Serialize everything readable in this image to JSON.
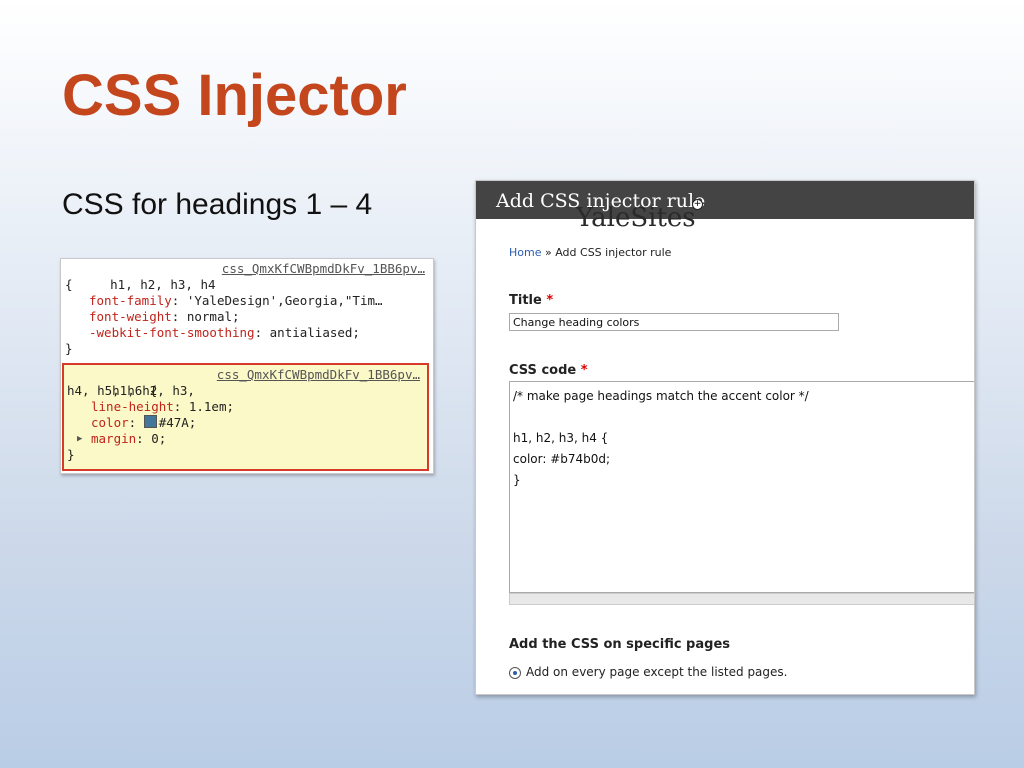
{
  "slide": {
    "title": "CSS Injector",
    "subtitle": "CSS for headings 1 – 4",
    "accent_color": "#c4461d"
  },
  "devtools": {
    "rule1": {
      "selector": "h1, h2, h3, h4",
      "source": "css_QmxKfCWBpmdDkFv_1BB6pv…",
      "open_brace": "{",
      "declarations": [
        {
          "prop": "font-family",
          "value": "'YaleDesign',Georgia,\"Tim…"
        },
        {
          "prop": "font-weight",
          "value": "normal;"
        },
        {
          "prop": "-webkit-font-smoothing",
          "value": "antialiased;"
        }
      ],
      "close_brace": "}"
    },
    "rule2": {
      "selector_line1": "h1, h2, h3,",
      "selector_line2": "h4, h5, h6 {",
      "source": "css_QmxKfCWBpmdDkFv_1BB6pv…",
      "declarations": [
        {
          "prop": "line-height",
          "value": "1.1em;"
        },
        {
          "prop": "color",
          "value": "#47A;",
          "swatch": "#447799"
        },
        {
          "prop": "margin",
          "value": "0;"
        }
      ],
      "close_brace": "}"
    }
  },
  "drupal": {
    "header_title": "Add CSS injector rule",
    "watermark": "YaleSites",
    "breadcrumb": {
      "home": "Home",
      "separator": " » ",
      "current": "Add CSS injector rule"
    },
    "title_label": "Title",
    "required_mark": "*",
    "title_value": "Change heading colors",
    "css_label": "CSS code",
    "css_lines": [
      "/* make page headings match the accent color */",
      "",
      "h1, h2, h3, h4 {",
      "color: #b74b0d;",
      "}"
    ],
    "pages_label": "Add the CSS on specific pages",
    "radio_label": "Add on every page except the listed pages."
  }
}
